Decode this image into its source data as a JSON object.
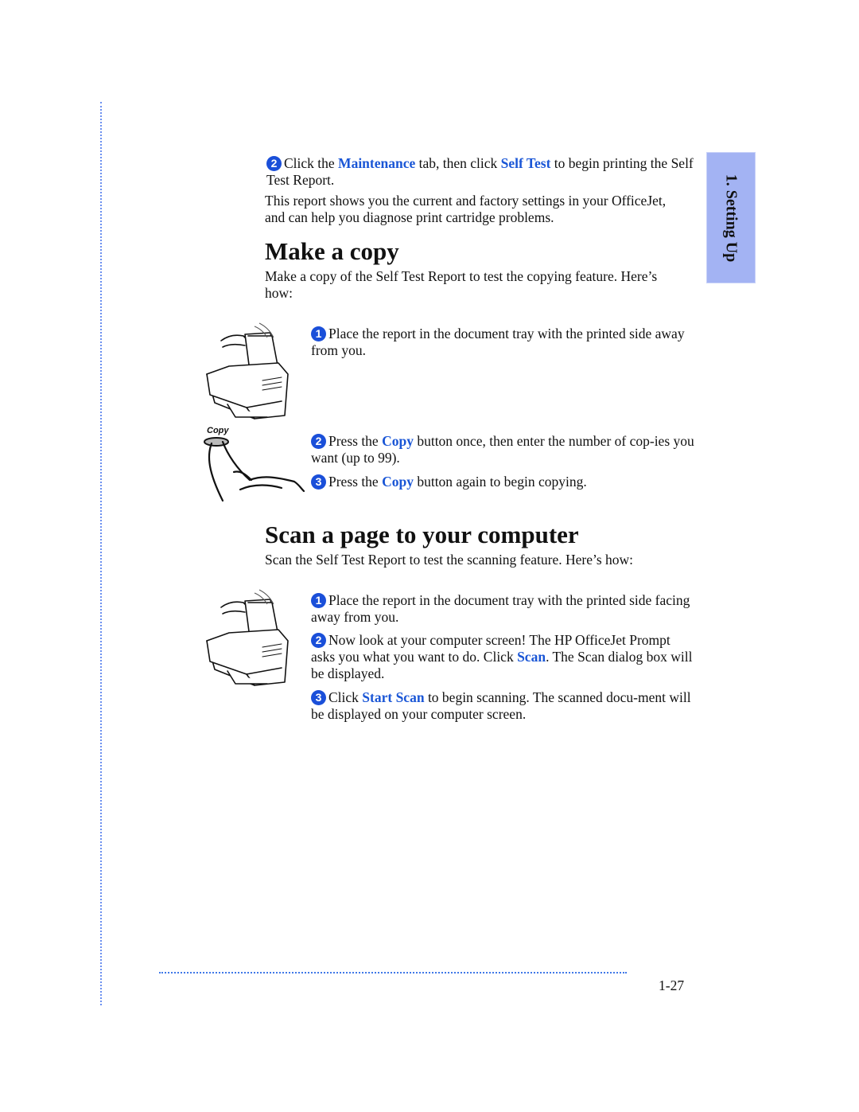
{
  "side_tab": {
    "label": "1. Setting Up",
    "color": "#a3b3f3"
  },
  "accent_color": "#1a56d6",
  "intro": {
    "step": {
      "number": "2",
      "pre": "Click the ",
      "link1": "Maintenance",
      "mid": " tab, then click ",
      "link2": "Self Test",
      "post": " to begin printing the Self Test Report."
    },
    "note": "This report shows you the current and factory settings in your OfficeJet, and can help you diagnose print cartridge problems."
  },
  "copy_section": {
    "title": "Make a copy",
    "intro": "Make a copy of the Self Test Report to test the copying feature. Here’s how:",
    "illustrations": {
      "printer_icon": "printer-with-paper-icon",
      "button_icon": "finger-pressing-copy-button-icon",
      "button_label": "Copy"
    },
    "steps": [
      {
        "number": "1",
        "text": "Place the report in the document tray with the printed side away from you."
      },
      {
        "number": "2",
        "pre": "Press the ",
        "link": "Copy",
        "post": " button once, then enter the number of cop-ies you want (up to 99)."
      },
      {
        "number": "3",
        "pre": "Press the ",
        "link": "Copy",
        "post": " button again to begin copying."
      }
    ]
  },
  "scan_section": {
    "title": "Scan a page to your computer",
    "intro": "Scan the Self Test Report to test the scanning feature. Here’s how:",
    "illustrations": {
      "printer_icon": "printer-with-paper-icon"
    },
    "steps": [
      {
        "number": "1",
        "text": "Place the report in the document tray with the printed side facing away from you."
      },
      {
        "number": "2",
        "pre": "Now look at your computer screen! The HP OfficeJet Prompt asks you what you want to do. Click ",
        "link": "Scan",
        "post": ". The Scan dialog box will be displayed."
      },
      {
        "number": "3",
        "pre": "Click ",
        "link": "Start Scan",
        "post": " to begin scanning. The scanned docu-ment will be displayed on your computer screen."
      }
    ]
  },
  "footer": {
    "page_number": "1-27"
  }
}
